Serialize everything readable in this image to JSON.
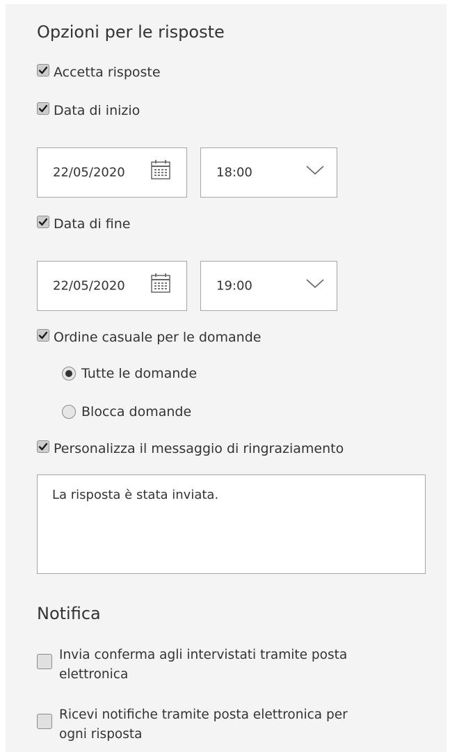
{
  "response_options": {
    "title": "Opzioni per le risposte",
    "accept_responses": {
      "label": "Accetta risposte",
      "checked": true
    },
    "start_date": {
      "label": "Data di inizio",
      "checked": true,
      "date": "22/05/2020",
      "time": "18:00"
    },
    "end_date": {
      "label": "Data di fine",
      "checked": true,
      "date": "22/05/2020",
      "time": "19:00"
    },
    "shuffle_questions": {
      "label": "Ordine casuale per le domande",
      "checked": true,
      "options": [
        {
          "label": "Tutte le domande",
          "selected": true
        },
        {
          "label": "Blocca domande",
          "selected": false
        }
      ]
    },
    "custom_thank_you": {
      "label": "Personalizza il messaggio di ringraziamento",
      "checked": true,
      "message": "La risposta è stata inviata."
    }
  },
  "notification": {
    "title": "Notifica",
    "send_receipt": {
      "label_line1": "Invia conferma agli intervistati tramite posta",
      "label_line2": "elettronica",
      "checked": false
    },
    "email_notify": {
      "label_line1": "Ricevi notifiche tramite posta elettronica per",
      "label_line2": "ogni risposta",
      "checked": false
    }
  },
  "icons": {
    "checkbox": "check-icon",
    "calendar": "calendar-icon",
    "dropdown": "chevron-down-icon"
  },
  "colors": {
    "panel_bg": "#f4f4f4",
    "text": "#333333",
    "border": "#a6a6a6"
  }
}
